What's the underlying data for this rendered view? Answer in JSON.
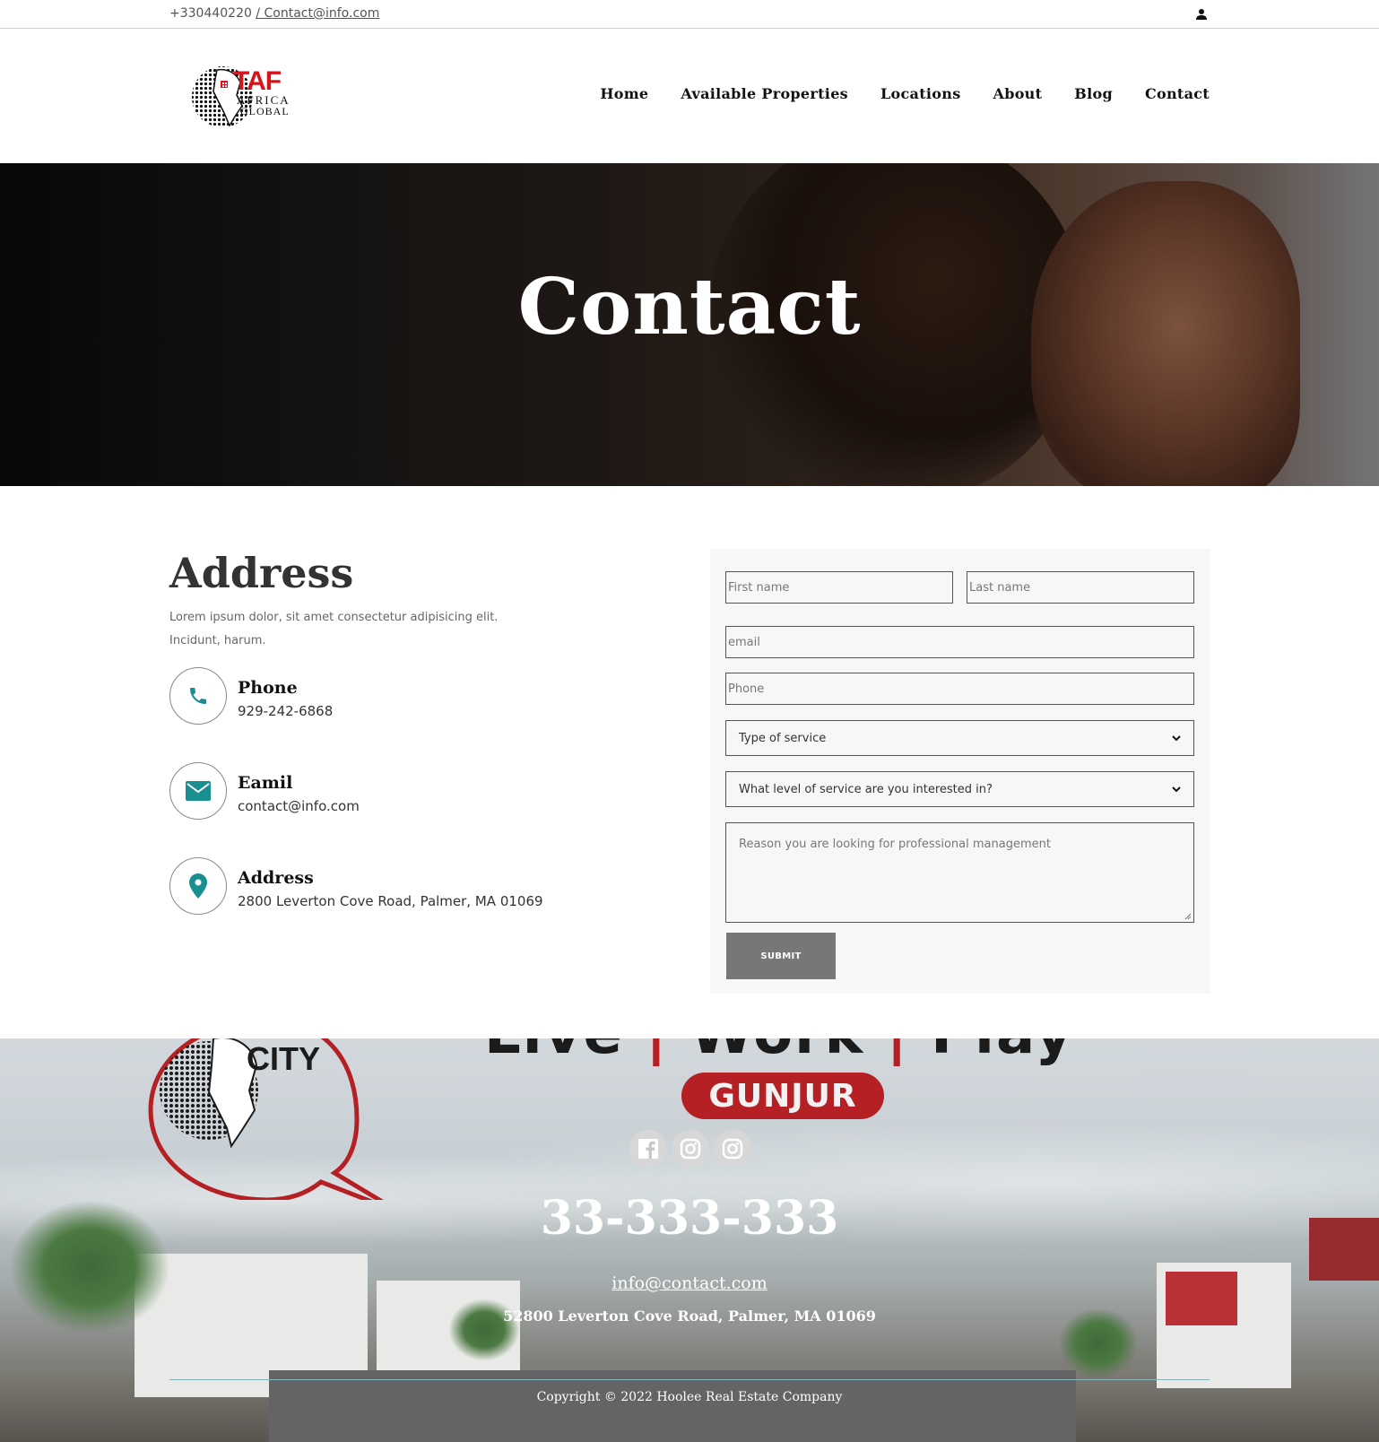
{
  "topbar": {
    "phone": "+330440220",
    "email_link": "/ Contact@info.com"
  },
  "header": {
    "logo_text_main": "TAF",
    "logo_text_line2": "AFRICA",
    "logo_text_line3": "GLOBAL",
    "nav": [
      "Home",
      "Available Properties",
      "Locations",
      "About",
      "Blog",
      "Contact"
    ]
  },
  "hero": {
    "title": "Contact"
  },
  "address_section": {
    "title": "Address",
    "description": "Lorem ipsum dolor, sit amet consectetur adipisicing elit. Incidunt, harum.",
    "items": [
      {
        "label": "Phone",
        "value": "929-242-6868",
        "icon": "phone-icon"
      },
      {
        "label": "Eamil",
        "value": "contact@info.com",
        "icon": "mail-icon"
      },
      {
        "label": "Address",
        "value": "2800 Leverton Cove Road, Palmer, MA 01069",
        "icon": "location-pin-icon"
      }
    ]
  },
  "form": {
    "first_name_placeholder": "First name",
    "last_name_placeholder": "Last name",
    "email_placeholder": "email",
    "phone_placeholder": "Phone",
    "service_type_selected": "Type of service",
    "service_level_selected": "What level of service are you interested in?",
    "reason_placeholder": "Reason you are looking for professional management",
    "submit_label": "SUBMIT"
  },
  "footer": {
    "banner_logo_text": "CITY",
    "banner_slogan": [
      "Live",
      "Work",
      "Play"
    ],
    "banner_location": "GUNJUR",
    "socials": [
      "facebook-icon",
      "instagram-icon",
      "instagram-icon"
    ],
    "phone": "33-333-333",
    "email": "info@contact.com",
    "address": "52800 Leverton Cove Road, Palmer, MA 01069",
    "copyright": "Copyright © 2022 Hoolee Real Estate Company"
  },
  "colors": {
    "accent_teal": "#1a8f8f",
    "brand_red": "#b52024",
    "submit_gray": "#777777"
  }
}
